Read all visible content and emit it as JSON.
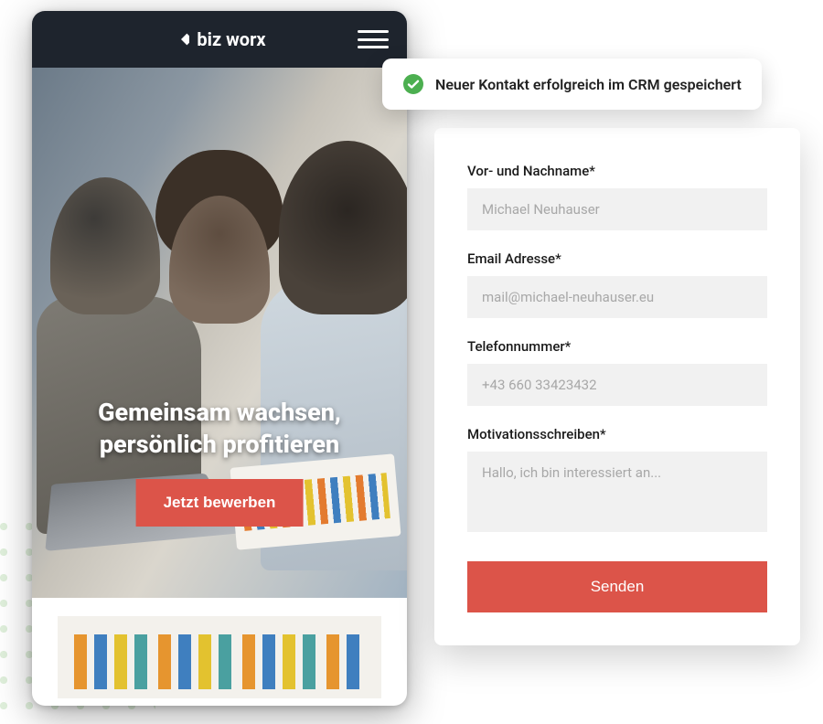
{
  "colors": {
    "accent": "#dc5449",
    "success": "#4caf50",
    "header_bg": "#1e242d"
  },
  "phone": {
    "brand": "biz worx",
    "hero_headline": "Gemeinsam wachsen,\npersönlich profitieren",
    "cta_label": "Jetzt bewerben"
  },
  "toast": {
    "message": "Neuer Kontakt erfolgreich im CRM gespeichert"
  },
  "form": {
    "fields": {
      "name": {
        "label": "Vor- und Nachname*",
        "placeholder": "Michael Neuhauser"
      },
      "email": {
        "label": "Email Adresse*",
        "placeholder": "mail@michael-neuhauser.eu"
      },
      "phone": {
        "label": "Telefonnummer*",
        "placeholder": "+43 660 33423432"
      },
      "message": {
        "label": "Motivationsschreiben*",
        "placeholder": "Hallo, ich bin interessiert an..."
      }
    },
    "submit_label": "Senden"
  }
}
